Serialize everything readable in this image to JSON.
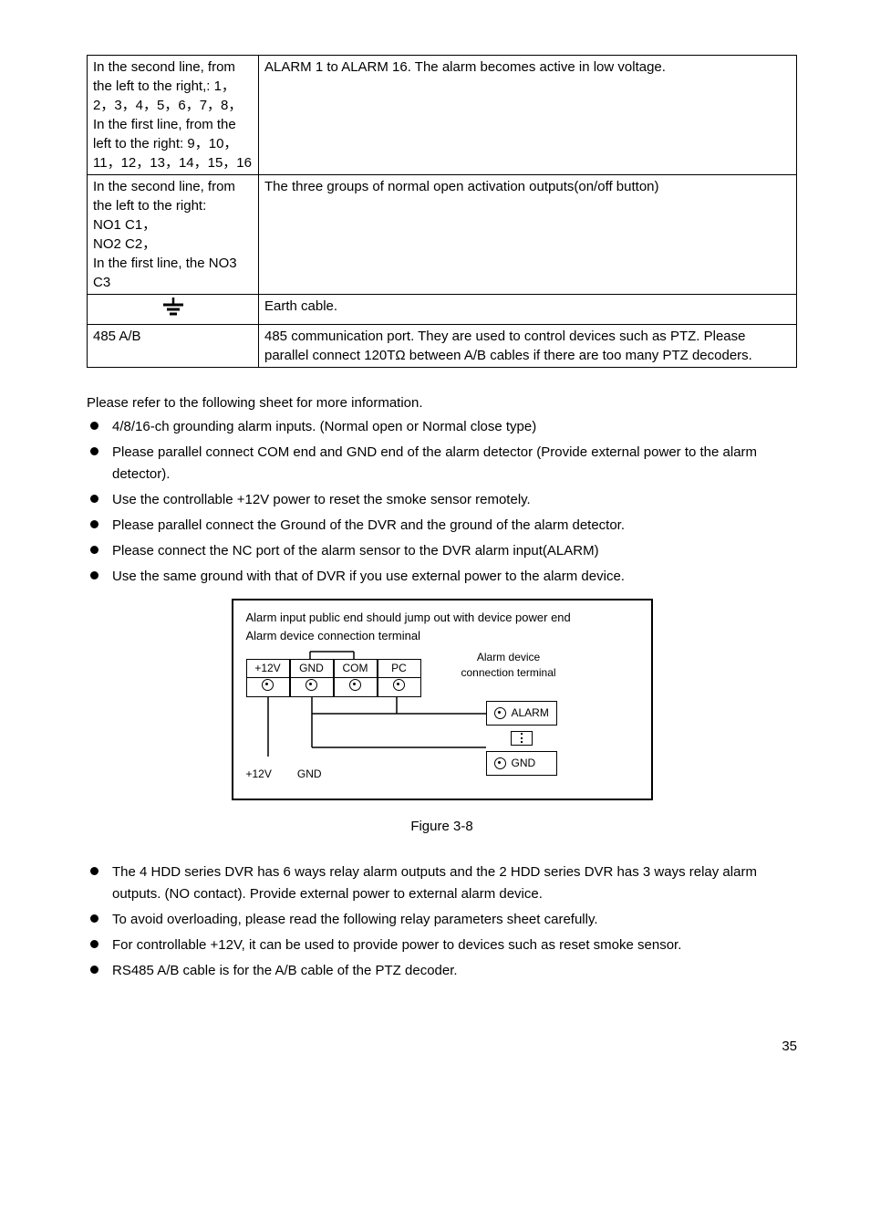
{
  "table": {
    "rows": [
      {
        "left": "In the second line, from the left to the right,: 1，2，3，4，5，6，7，8，\nIn the first line, from the left to the right: 9，10，11，12，13，14，15，16",
        "right": "ALARM 1 to ALARM 16. The alarm becomes active in low voltage."
      },
      {
        "left": "In the second line, from the left to the right:\nNO1 C1，\nNO2 C2，\nIn the first line, the NO3 C3",
        "right": "The  three groups of normal open activation outputs(on/off button)"
      },
      {
        "left": "__EARTH_ICON__",
        "right": "Earth cable."
      },
      {
        "left": "485 A/B",
        "right": "485 communication port. They are used to control devices such as PTZ. Please parallel connect 120TΩ between A/B cables if there are too many PTZ decoders."
      }
    ]
  },
  "intro": "Please refer to the following sheet for more information.",
  "bullets1": [
    "4/8/16-ch grounding alarm inputs. (Normal open or Normal close type)",
    "Please parallel connect COM end and GND end of the alarm detector (Provide external power to the alarm detector).",
    "Use the controllable +12V power to reset the smoke sensor remotely.",
    "Please parallel connect the Ground of the DVR and the ground of the alarm detector.",
    "Please connect the NC port of the alarm sensor to the DVR alarm input(ALARM)",
    "Use the same ground with that of DVR if you use external power to the alarm device."
  ],
  "diagram": {
    "title1": "Alarm input public end should jump out with device power end",
    "title2": "Alarm device connection terminal",
    "headers": [
      "+12V",
      "GND",
      "COM",
      "PC"
    ],
    "device_title": "Alarm device",
    "device_sub": "connection terminal",
    "alarm": "ALARM",
    "gnd": "GND",
    "bottom_12v": "+12V",
    "bottom_gnd": "GND"
  },
  "figure_caption": "Figure 3-8",
  "bullets2": [
    "The 4 HDD series DVR has 6 ways relay alarm outputs and the 2 HDD series DVR has 3 ways relay alarm outputs. (NO contact). Provide external power to external alarm device.",
    "To avoid overloading, please read the following relay parameters sheet carefully.",
    "For controllable +12V, it can be used to provide power to devices such as reset smoke sensor.",
    "RS485 A/B cable is for the A/B cable of the PTZ decoder."
  ],
  "page_number": "35"
}
